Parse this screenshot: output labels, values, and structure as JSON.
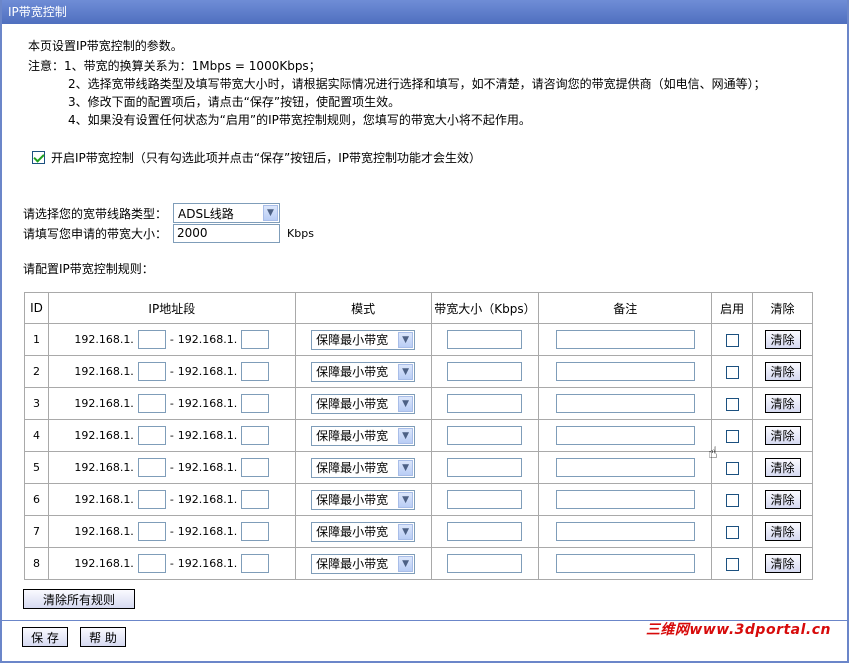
{
  "title": "IP带宽控制",
  "intro": "本页设置IP带宽控制的参数。",
  "notes": [
    "注意：1、带宽的换算关系为：1Mbps = 1000Kbps；",
    "2、选择宽带线路类型及填写带宽大小时，请根据实际情况进行选择和填写，如不清楚，请咨询您的带宽提供商（如电信、网通等）；",
    "3、修改下面的配置项后，请点击“保存”按钮，使配置项生效。",
    "4、如果没有设置任何状态为“启用”的IP带宽控制规则，您填写的带宽大小将不起作用。"
  ],
  "enable": {
    "checked": true,
    "label": "开启IP带宽控制（只有勾选此项并点击“保存”按钮后，IP带宽控制功能才会生效）"
  },
  "line_type": {
    "label": "请选择您的宽带线路类型：",
    "value": "ADSL线路"
  },
  "bandwidth": {
    "label": "请填写您申请的带宽大小：",
    "value": "2000",
    "unit": "Kbps"
  },
  "rules_label": "请配置IP带宽控制规则：",
  "table": {
    "headers": [
      "ID",
      "IP地址段",
      "模式",
      "带宽大小（Kbps）",
      "备注",
      "启用",
      "清除"
    ],
    "ip_prefix": "192.168.1.",
    "separator": "-",
    "mode_value": "保障最小带宽",
    "clear_label": "清除",
    "rows": [
      {
        "id": "1"
      },
      {
        "id": "2"
      },
      {
        "id": "3"
      },
      {
        "id": "4"
      },
      {
        "id": "5"
      },
      {
        "id": "6"
      },
      {
        "id": "7"
      },
      {
        "id": "8"
      }
    ]
  },
  "clear_all": "清除所有规则",
  "save": "保 存",
  "help": "帮 助",
  "watermark": "三维网www.3dportal.cn",
  "colors": {
    "title_bar": "#5b7bcb",
    "border": "#6b86c9",
    "check": "#21a121",
    "watermark": "#d70b0b"
  }
}
